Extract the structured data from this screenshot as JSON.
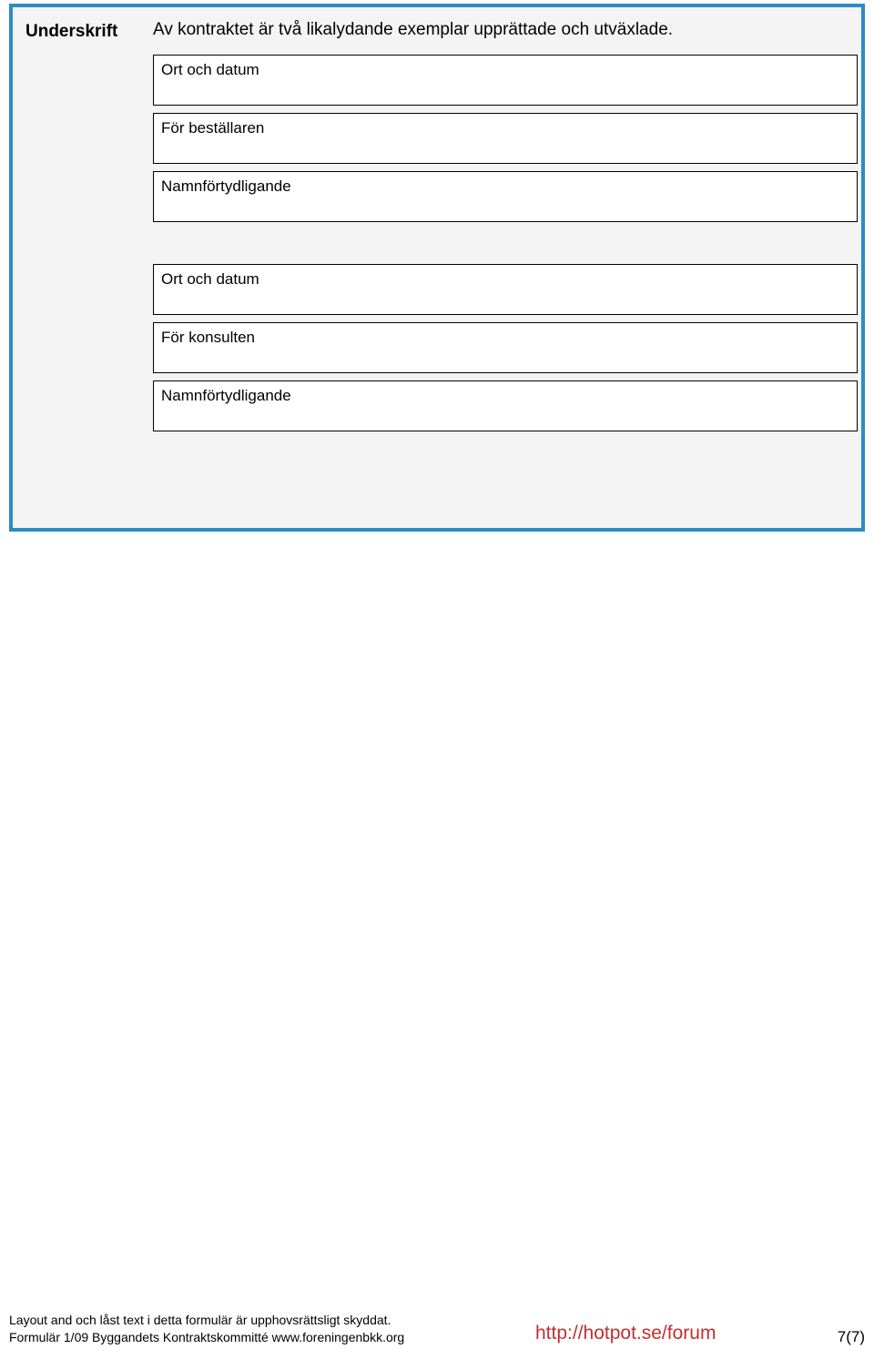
{
  "section": {
    "title": "Underskrift",
    "intro": "Av kontraktet är två likalydande exemplar upprättade och utväxlade."
  },
  "groups": [
    {
      "fields": [
        {
          "label": "Ort och datum"
        },
        {
          "label": "För beställaren"
        },
        {
          "label": "Namnförtydligande"
        }
      ]
    },
    {
      "fields": [
        {
          "label": "Ort och datum"
        },
        {
          "label": "För konsulten"
        },
        {
          "label": "Namnförtydligande"
        }
      ]
    }
  ],
  "footer": {
    "line1": "Layout and och låst text i detta formulär är upphovsrättsligt skyddat.",
    "line2": "Formulär 1/09 Byggandets Kontraktskommitté  www.foreningenbkk.org",
    "link": "http://hotpot.se/forum",
    "page": "7(7)"
  }
}
